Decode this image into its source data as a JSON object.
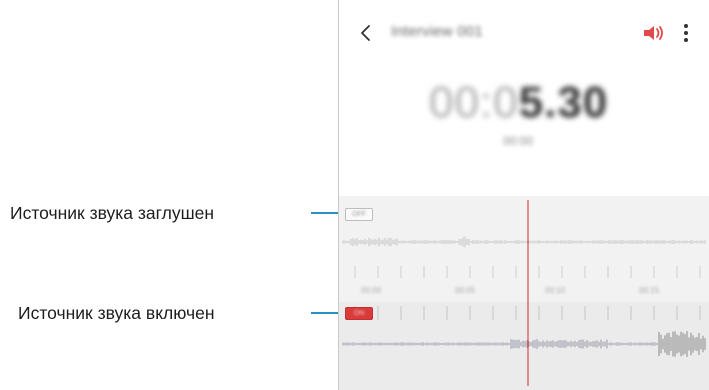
{
  "callouts": {
    "muted": "Источник звука заглушен",
    "on": "Источник звука включен"
  },
  "appbar": {
    "title": "Interview 001"
  },
  "timer": {
    "dim_part": "00:0",
    "bold_part": "5.30",
    "date": "00:00"
  },
  "tracks": {
    "muted_label": "OFF",
    "on_label": "ON"
  },
  "timeline": {
    "labels": [
      "00:00",
      "00:05",
      "00:10",
      "00:15"
    ]
  },
  "colors": {
    "accent": "#d93a3a",
    "leader": "#2a8fc7",
    "playhead": "#d94a4a"
  },
  "icons": {
    "back": "chevron-left-icon",
    "speaker": "speaker-on-icon",
    "more": "more-vertical-icon"
  }
}
